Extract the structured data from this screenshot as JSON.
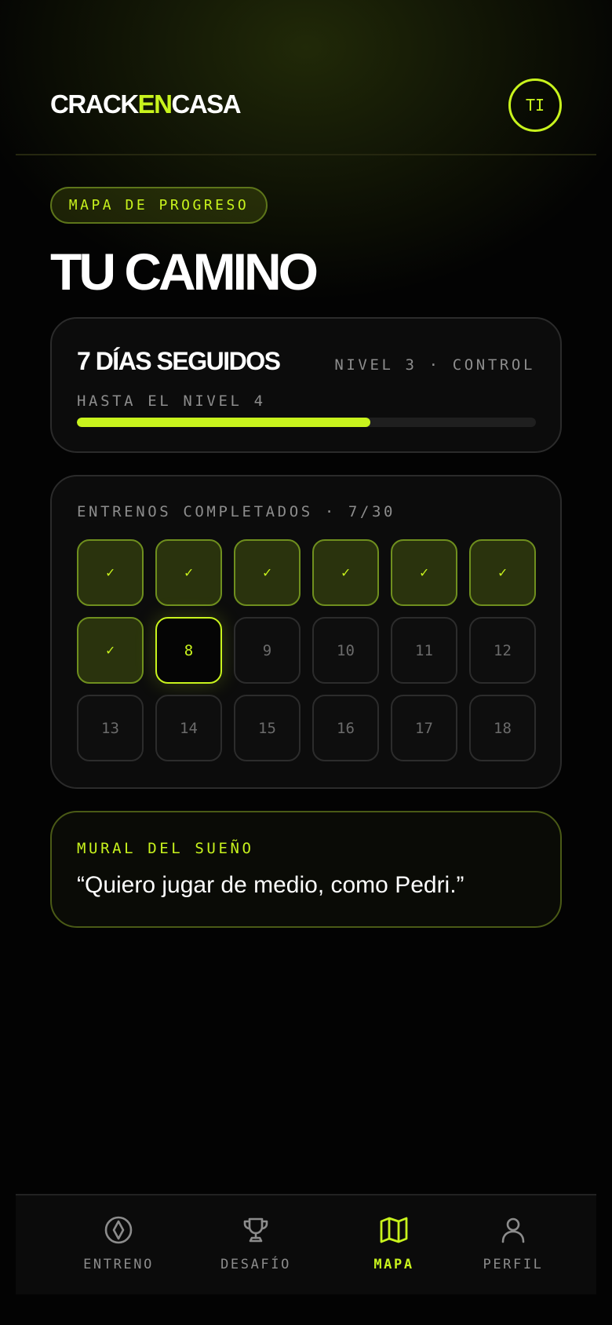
{
  "header": {
    "logo_part1": "CRACK",
    "logo_part2": "EN",
    "logo_part3": "CASA",
    "avatar_initials": "TI"
  },
  "page": {
    "badge": "MAPA DE PROGRESO",
    "title": "TU CAMINO"
  },
  "streak": {
    "title": "7 DÍAS SEGUIDOS",
    "level": "NIVEL 3 · CONTROL",
    "subtitle": "HASTA EL NIVEL 4",
    "progress": 0.64
  },
  "trainings": {
    "label": "ENTRENOS COMPLETADOS · 7/30",
    "check_glyph": "✓",
    "days": [
      {
        "n": "1",
        "state": "done"
      },
      {
        "n": "2",
        "state": "done"
      },
      {
        "n": "3",
        "state": "done"
      },
      {
        "n": "4",
        "state": "done"
      },
      {
        "n": "5",
        "state": "done"
      },
      {
        "n": "6",
        "state": "done"
      },
      {
        "n": "7",
        "state": "done"
      },
      {
        "n": "8",
        "state": "current"
      },
      {
        "n": "9",
        "state": "locked"
      },
      {
        "n": "10",
        "state": "locked"
      },
      {
        "n": "11",
        "state": "locked"
      },
      {
        "n": "12",
        "state": "locked"
      },
      {
        "n": "13",
        "state": "locked"
      },
      {
        "n": "14",
        "state": "locked"
      },
      {
        "n": "15",
        "state": "locked"
      },
      {
        "n": "16",
        "state": "locked"
      },
      {
        "n": "17",
        "state": "locked"
      },
      {
        "n": "18",
        "state": "locked"
      }
    ]
  },
  "dream": {
    "label": "MURAL DEL SUEÑO",
    "quote": "“Quiero jugar de medio, como Pedri.”"
  },
  "nav": {
    "items": [
      {
        "label": "ENTRENO",
        "icon": "compass-icon",
        "active": false
      },
      {
        "label": "DESAFÍO",
        "icon": "trophy-icon",
        "active": false
      },
      {
        "label": "MAPA",
        "icon": "map-icon",
        "active": true
      },
      {
        "label": "PERFIL",
        "icon": "user-icon",
        "active": false
      }
    ]
  },
  "colors": {
    "accent": "#c8f31d",
    "background": "#030303",
    "card": "#0c0c0c",
    "muted": "#8d8d8d"
  }
}
